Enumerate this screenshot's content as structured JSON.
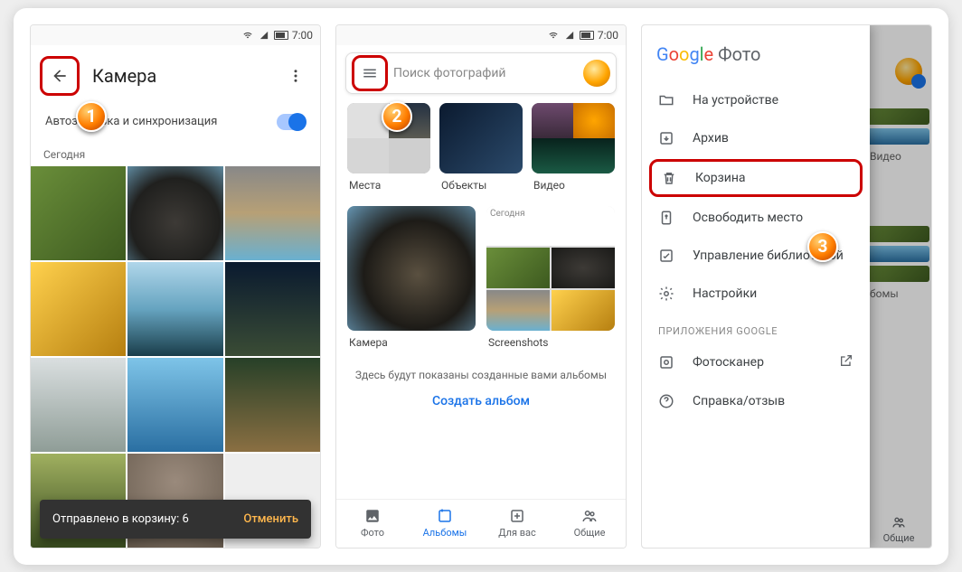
{
  "statusbar": {
    "time": "7:00"
  },
  "screen1": {
    "title": "Камера",
    "auto_upload_label": "Автозагрузка и синхронизация",
    "section_today": "Сегодня",
    "snackbar_text": "Отправлено в корзину: 6",
    "snackbar_action": "Отменить"
  },
  "screen2": {
    "search_placeholder": "Поиск фотографий",
    "categories": {
      "places": "Места",
      "objects": "Объекты",
      "video": "Видео"
    },
    "albums": {
      "camera": "Камера",
      "screenshots": "Screenshots",
      "scr_header": "Сегодня"
    },
    "hint": "Здесь будут показаны созданные вами альбомы",
    "create": "Создать альбом",
    "nav": {
      "photos": "Фото",
      "albums": "Альбомы",
      "foryou": "Для вас",
      "shared": "Общие"
    }
  },
  "screen3": {
    "brand_suffix": "Фото",
    "menu": {
      "device": "На устройстве",
      "archive": "Архив",
      "trash": "Корзина",
      "free": "Освободить место",
      "library": "Управление библиотекой",
      "settings": "Настройки"
    },
    "apps_header": "ПРИЛОЖЕНИЯ GOOGLE",
    "scanner": "Фотосканер",
    "help": "Справка/отзыв",
    "bg_video_label": "Видео",
    "bg_other_label": "бомы",
    "bg_nav": "Общие"
  },
  "callouts": {
    "n1": "1",
    "n2": "2",
    "n3": "3"
  }
}
